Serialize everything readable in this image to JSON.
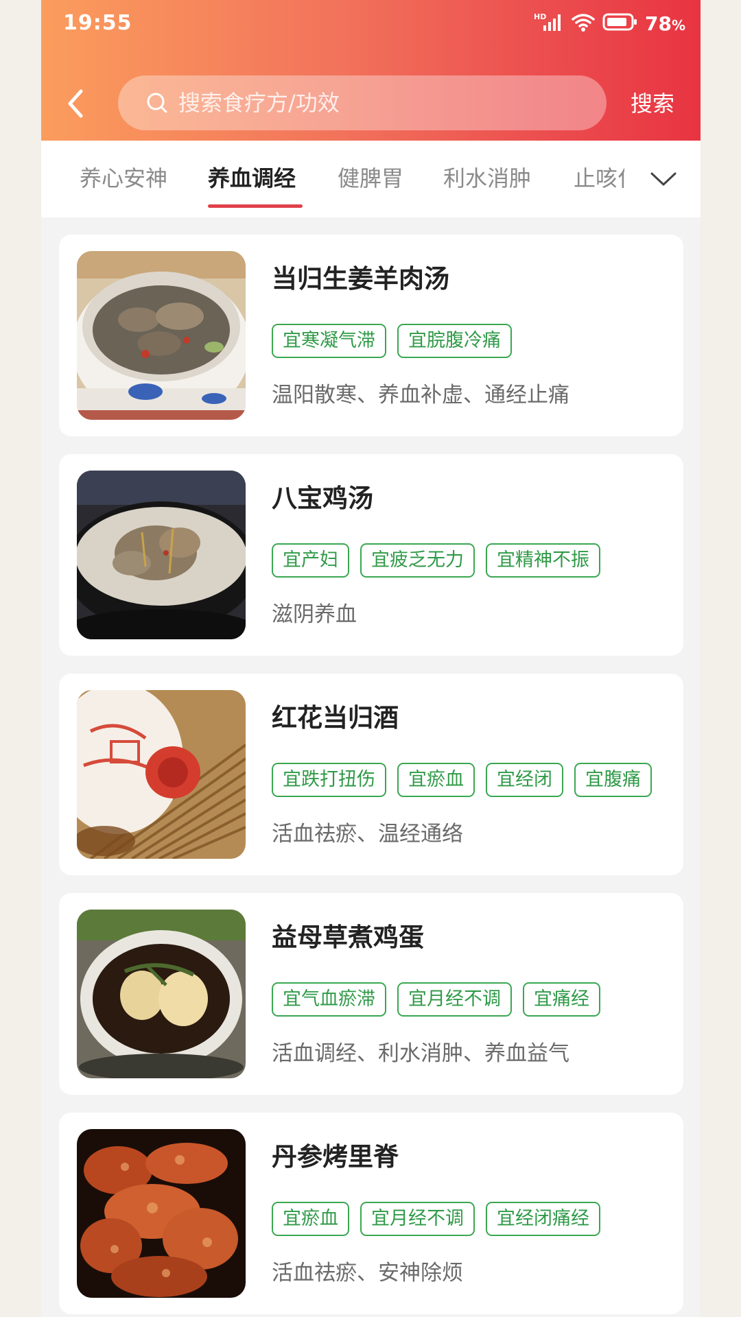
{
  "status_bar": {
    "time": "19:55",
    "network": "HD",
    "battery": "78",
    "battery_unit": "%"
  },
  "search": {
    "placeholder": "搜索食疗方/功效",
    "button_label": "搜索"
  },
  "tabs": [
    {
      "label": "养心安神",
      "active": false
    },
    {
      "label": "养血调经",
      "active": true
    },
    {
      "label": "健脾胃",
      "active": false
    },
    {
      "label": "利水消肿",
      "active": false
    },
    {
      "label": "止咳化",
      "active": false
    }
  ],
  "recipes": [
    {
      "title": "当归生姜羊肉汤",
      "tags": [
        "宜寒凝气滞",
        "宜脘腹冷痛"
      ],
      "desc": "温阳散寒、养血补虚、通经止痛",
      "image": "lamb-soup-bowl"
    },
    {
      "title": "八宝鸡汤",
      "tags": [
        "宜产妇",
        "宜疲乏无力",
        "宜精神不振"
      ],
      "desc": "滋阴养血",
      "image": "chicken-soup-pot"
    },
    {
      "title": "红花当归酒",
      "tags": [
        "宜跌打扭伤",
        "宜瘀血",
        "宜经闭",
        "宜腹痛"
      ],
      "desc": "活血祛瘀、温经通络",
      "image": "wine-jar"
    },
    {
      "title": "益母草煮鸡蛋",
      "tags": [
        "宜气血瘀滞",
        "宜月经不调",
        "宜痛经"
      ],
      "desc": "活血调经、利水消肿、养血益气",
      "image": "herbal-eggs-bowl"
    },
    {
      "title": "丹参烤里脊",
      "tags": [
        "宜瘀血",
        "宜月经不调",
        "宜经闭痛经"
      ],
      "desc": "活血祛瘀、安神除烦",
      "image": "roasted-pork"
    }
  ],
  "colors": {
    "header_start": "#fb9d5d",
    "header_end": "#e83442",
    "tag_green": "#3aa751",
    "tab_indicator": "#e0414a"
  }
}
